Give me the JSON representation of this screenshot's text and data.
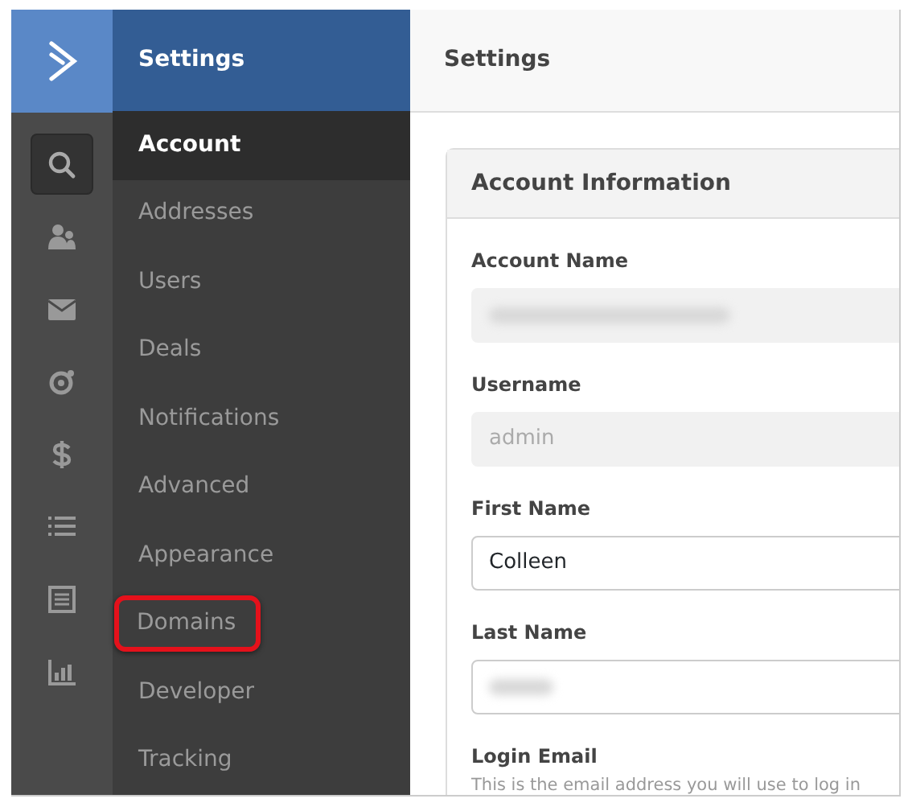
{
  "brand": {
    "title": "Settings"
  },
  "rail": [
    {
      "kind": "search",
      "selected": true
    },
    {
      "kind": "contacts",
      "selected": false
    },
    {
      "kind": "mail",
      "selected": false
    },
    {
      "kind": "automation",
      "selected": false
    },
    {
      "kind": "dollar",
      "selected": false
    },
    {
      "kind": "list",
      "selected": false
    },
    {
      "kind": "form",
      "selected": false
    },
    {
      "kind": "chart",
      "selected": false
    }
  ],
  "menu": [
    {
      "label": "Account",
      "selected": true,
      "highlighted": false
    },
    {
      "label": "Addresses",
      "selected": false,
      "highlighted": false
    },
    {
      "label": "Users",
      "selected": false,
      "highlighted": false
    },
    {
      "label": "Deals",
      "selected": false,
      "highlighted": false
    },
    {
      "label": "Notifications",
      "selected": false,
      "highlighted": false
    },
    {
      "label": "Advanced",
      "selected": false,
      "highlighted": false
    },
    {
      "label": "Appearance",
      "selected": false,
      "highlighted": false
    },
    {
      "label": "Domains",
      "selected": false,
      "highlighted": true
    },
    {
      "label": "Developer",
      "selected": false,
      "highlighted": false
    },
    {
      "label": "Tracking",
      "selected": false,
      "highlighted": false
    }
  ],
  "page_title": "Settings",
  "card": {
    "title": "Account Information",
    "fields": [
      {
        "label": "Account Name",
        "disabled": true,
        "redacted": true
      },
      {
        "label": "Username",
        "value": "admin",
        "disabled": true,
        "redacted": false
      },
      {
        "label": "First Name",
        "value": "Colleen",
        "disabled": false,
        "redacted": false
      },
      {
        "label": "Last Name",
        "disabled": false,
        "redacted": true
      },
      {
        "label": "Login Email",
        "help": "This is the email address you will use to log in"
      }
    ]
  }
}
